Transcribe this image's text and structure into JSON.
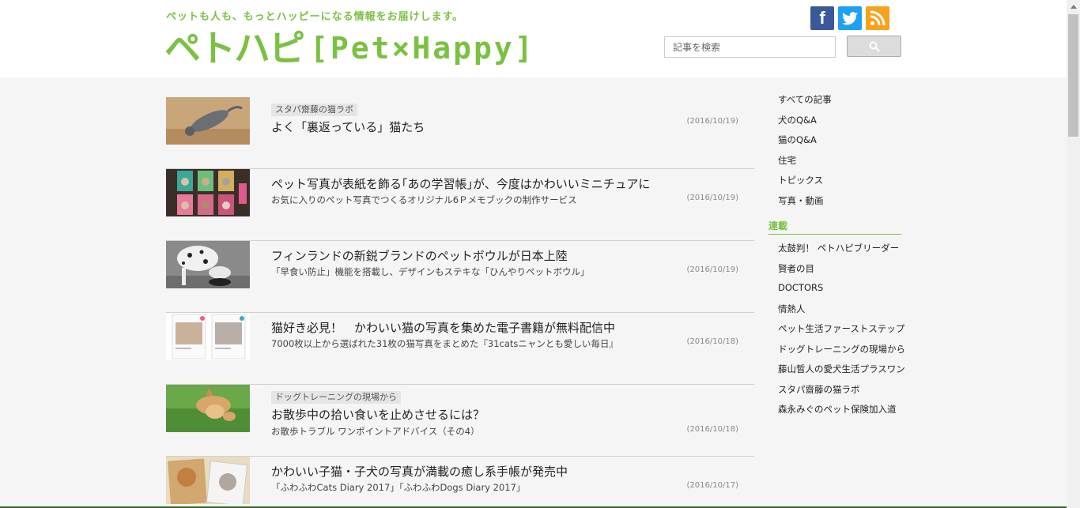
{
  "header": {
    "tagline": "ペットも人も、もっとハッピーになる情報をお届けします。",
    "logo_jp": "ペトハピ",
    "logo_en": "[Pet×Happy]",
    "search_placeholder": "記事を検索",
    "social_facebook": "f"
  },
  "articles": [
    {
      "badge": "スタパ齋藤の猫ラボ",
      "title": "よく「裏返っている」猫たち",
      "sub": "",
      "date": "(2016/10/19)"
    },
    {
      "badge": "",
      "title": "ペット写真が表紙を飾る｢あの学習帳｣が、今度はかわいいミニチュアに",
      "sub": "お気に入りのペット写真でつくるオリジナル6Ｐメモブックの制作サービス",
      "date": "(2016/10/19)"
    },
    {
      "badge": "",
      "title": "フィンランドの新鋭ブランドのペットボウルが日本上陸",
      "sub": "「早食い防止」機能を搭載し、デザインもステキな「ひんやりペットボウル」",
      "date": "(2016/10/19)"
    },
    {
      "badge": "",
      "title": "猫好き必見！　かわいい猫の写真を集めた電子書籍が無料配信中",
      "sub": "7000枚以上から選ばれた31枚の猫写真をまとめた『31catsニャンとも愛しい毎日』",
      "date": "(2016/10/18)"
    },
    {
      "badge": "ドッグトレーニングの現場から",
      "title": "お散歩中の拾い食いを止めさせるには？",
      "sub": "お散歩トラブル ワンポイントアドバイス（その4）",
      "date": "(2016/10/18)"
    },
    {
      "badge": "",
      "title": "かわいい子猫・子犬の写真が満載の癒し系手帳が発売中",
      "sub": "「ふわふわCats Diary 2017」「ふわふわDogs Diary 2017」",
      "date": "(2016/10/17)"
    }
  ],
  "sidebar": {
    "categories": [
      "すべての記事",
      "犬のQ&A",
      "猫のQ&A",
      "住宅",
      "トピックス",
      "写真・動画"
    ],
    "series_heading": "連載",
    "series": [
      "太鼓判！ ペトハピブリーダー",
      "賢者の目",
      "DOCTORS",
      "情熱人",
      "ペット生活ファーストステップ",
      "ドッグトレーニングの現場から",
      "藤山晳人の愛犬生活プラスワン",
      "スタパ齋藤の猫ラボ",
      "森永みぐのペット保険加入道"
    ]
  },
  "colors": {
    "brand": "#7ac142",
    "facebook": "#3b5998",
    "twitter": "#1da1f2",
    "rss": "#f7a21b"
  }
}
